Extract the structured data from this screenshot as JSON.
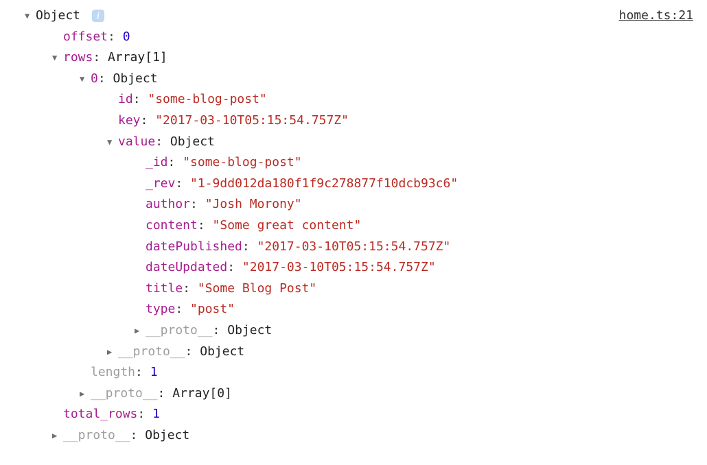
{
  "source": {
    "file": "home.ts",
    "line": "21",
    "label": "home.ts:21"
  },
  "root": {
    "label": "Object",
    "offset_key": "offset",
    "offset_val": "0",
    "rows_key": "rows",
    "rows_type": "Array[1]",
    "row0": {
      "index": "0",
      "type": "Object",
      "id_key": "id",
      "id_val": "\"some-blog-post\"",
      "key_key": "key",
      "key_val": "\"2017-03-10T05:15:54.757Z\"",
      "value_key": "value",
      "value_type": "Object",
      "value": {
        "_id_key": "_id",
        "_id_val": "\"some-blog-post\"",
        "_rev_key": "_rev",
        "_rev_val": "\"1-9dd012da180f1f9c278877f10dcb93c6\"",
        "author_key": "author",
        "author_val": "\"Josh Morony\"",
        "content_key": "content",
        "content_val": "\"Some great content\"",
        "datePublished_key": "datePublished",
        "datePublished_val": "\"2017-03-10T05:15:54.757Z\"",
        "dateUpdated_key": "dateUpdated",
        "dateUpdated_val": "\"2017-03-10T05:15:54.757Z\"",
        "title_key": "title",
        "title_val": "\"Some Blog Post\"",
        "type_key": "type",
        "type_val": "\"post\"",
        "proto_key": "__proto__",
        "proto_type": "Object"
      },
      "proto_key": "__proto__",
      "proto_type": "Object"
    },
    "length_key": "length",
    "length_val": "1",
    "rows_proto_key": "__proto__",
    "rows_proto_type": "Array[0]",
    "total_rows_key": "total_rows",
    "total_rows_val": "1",
    "proto_key": "__proto__",
    "proto_type": "Object"
  },
  "info_badge": "i"
}
